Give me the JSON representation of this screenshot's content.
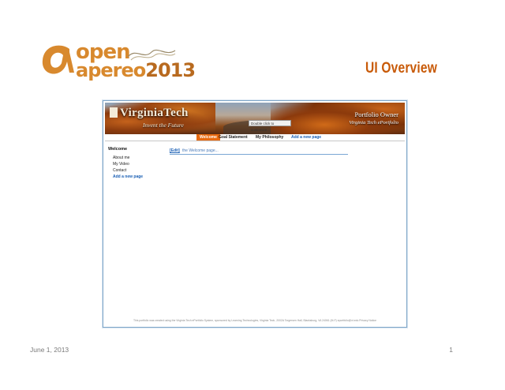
{
  "logo": {
    "line1": "open",
    "line2": "apereo",
    "year": "2013"
  },
  "slide": {
    "title": "UI Overview",
    "date": "June 1, 2013",
    "page_number": "1"
  },
  "banner": {
    "brand": "VirginiaTech",
    "tagline": "Invent the Future",
    "dblclick_hint": "Double click to customize...",
    "owner": "Portfolio Owner",
    "portfolio_name": "Virginia Tech ePortfolio"
  },
  "nav": {
    "tabs": [
      {
        "label": "Welcome",
        "active": true
      },
      {
        "label": "Goal Statement",
        "active": false
      },
      {
        "label": "My Philosophy",
        "active": false
      },
      {
        "label": "Add a new page",
        "active": false
      }
    ]
  },
  "sidebar": {
    "title": "Welcome",
    "items": [
      "About me",
      "My Video",
      "Contact"
    ],
    "add_label": "Add a new page"
  },
  "main": {
    "edit_label": "[Edit]",
    "text": "the Welcome page..."
  },
  "footer": {
    "text": "This portfolio was created using the Virginia Tech ePortfolio System, sponsored by Learning Technologies, Virginia Tech, 2002A Torgersen Hall, Blacksburg, VA 24061 (M-F) eportfolio@vt.edu Privacy Notice"
  },
  "colors": {
    "accent": "#c85a08",
    "tab_active": "#e86a10",
    "link": "#1a5fb4",
    "frame": "#7fa6c8"
  }
}
